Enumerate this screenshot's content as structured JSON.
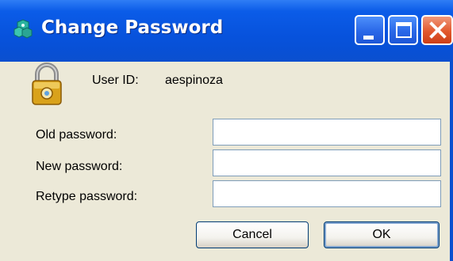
{
  "window": {
    "title": "Change Password",
    "icons": {
      "app": "app-icon",
      "minimize": "minimize-icon",
      "maximize": "maximize-icon",
      "close": "close-icon"
    }
  },
  "user": {
    "icon": "lock-icon",
    "label": "User ID:",
    "value": "aespinoza"
  },
  "fields": {
    "old_password": {
      "label": "Old password:",
      "value": ""
    },
    "new_password": {
      "label": "New password:",
      "value": ""
    },
    "retype_password": {
      "label": "Retype password:",
      "value": ""
    }
  },
  "buttons": {
    "cancel": "Cancel",
    "ok": "OK"
  },
  "colors": {
    "titlebar": "#0752dc",
    "client_bg": "#ece9d8",
    "close_button": "#e2582d",
    "input_border": "#7f9db9"
  }
}
